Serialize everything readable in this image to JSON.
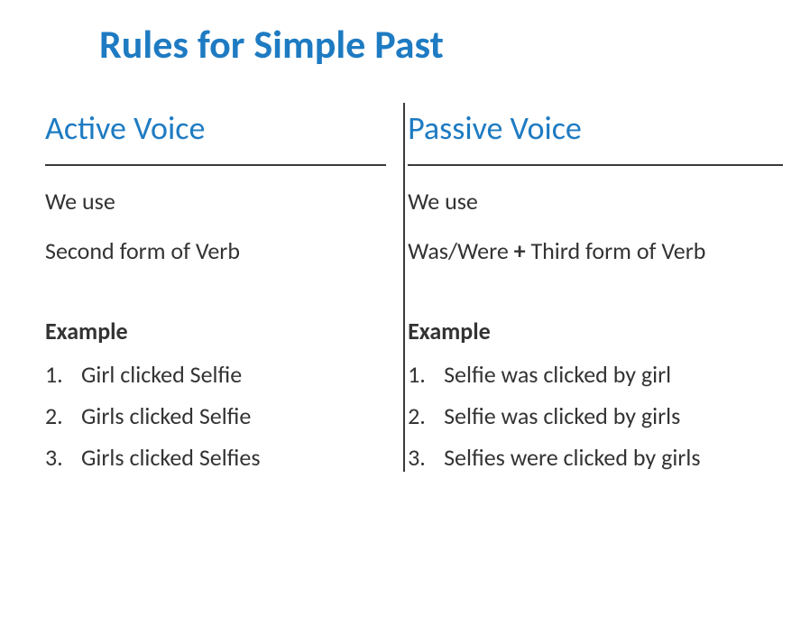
{
  "title": "Rules for Simple Past",
  "active": {
    "header": "Active Voice",
    "we_use": "We use",
    "formula": "Second form of Verb",
    "example_label": "Example",
    "examples": [
      {
        "num": "1.",
        "text": "Girl clicked Selfie"
      },
      {
        "num": "2.",
        "text": "Girls clicked Selfie"
      },
      {
        "num": "3.",
        "text": "Girls clicked Selfies"
      }
    ]
  },
  "passive": {
    "header": "Passive Voice",
    "we_use": "We use",
    "formula_pre": "Was/Were ",
    "formula_plus": "+",
    "formula_post": " Third form of Verb",
    "example_label": "Example",
    "examples": [
      {
        "num": "1.",
        "text": "Selfie was clicked by girl"
      },
      {
        "num": "2.",
        "text": "Selfie was clicked by girls"
      },
      {
        "num": "3.",
        "text": "Selfies were clicked by girls"
      }
    ]
  }
}
